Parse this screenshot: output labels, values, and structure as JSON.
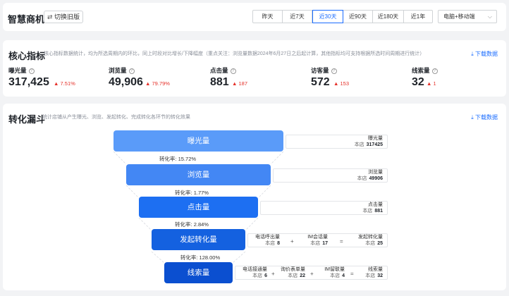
{
  "header": {
    "title": "智慧商机",
    "old_version_label": "切换旧版",
    "ranges": [
      "昨天",
      "近7天",
      "近30天",
      "近90天",
      "近180天",
      "近1年"
    ],
    "active_range": "近30天",
    "device_select": "电脑+移动端"
  },
  "core": {
    "title": "核心指标",
    "desc": "核心指标数据统计，均为所选周期内的环比，同上时段对比增长/下降幅度（重点关注：浏览量数据2024年6月27日之后起计算，其他指标均可支持根据所选时间周期进行统计）",
    "download": "下载数据",
    "metrics": [
      {
        "label": "曝光量",
        "value": "317,425",
        "change": "7.51%"
      },
      {
        "label": "浏览量",
        "value": "49,906",
        "change": "79.79%"
      },
      {
        "label": "点击量",
        "value": "881",
        "change": "187"
      },
      {
        "label": "访客量",
        "value": "572",
        "change": "153"
      },
      {
        "label": "线索量",
        "value": "32",
        "change": "1"
      }
    ]
  },
  "funnel": {
    "title": "转化漏斗",
    "desc": "统计店铺从产生曝光、浏览、发起转化、完成转化各环节的转化效果",
    "download": "下载数据",
    "store_label": "本店",
    "stages": [
      "曝光量",
      "浏览量",
      "点击量",
      "发起转化量",
      "线索量"
    ],
    "rates": [
      "转化率: 15.72%",
      "转化率: 1.77%",
      "转化率: 2.84%",
      "转化率: 128.00%"
    ],
    "colors": [
      "#5a9bf9",
      "#4387f4",
      "#1d6ff2",
      "#1461e0",
      "#0b4fd0"
    ],
    "details": {
      "exposure": {
        "name": "曝光量",
        "value": "317425"
      },
      "browse": {
        "name": "浏览量",
        "value": "49906"
      },
      "click": {
        "name": "点击量",
        "value": "881"
      },
      "initiate": [
        {
          "name": "电话呼出量",
          "value": "8"
        },
        {
          "name": "IM会话量",
          "value": "17"
        },
        {
          "name": "发起转化量",
          "value": "25"
        }
      ],
      "lead": [
        {
          "name": "电话接通量",
          "value": "6"
        },
        {
          "name": "询价表单量",
          "value": "22"
        },
        {
          "name": "IM留联量",
          "value": "4"
        },
        {
          "name": "线索量",
          "value": "32"
        }
      ]
    },
    "ops": {
      "plus": "+",
      "eq": "="
    }
  }
}
